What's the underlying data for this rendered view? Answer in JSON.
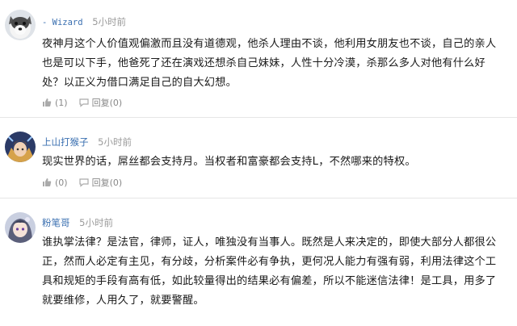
{
  "comments": [
    {
      "user": "- Wizard",
      "time": "5小时前",
      "lines": [
        "夜神月这个人价值观偏激而且没有道德观，他杀人理由不谈，他利用女朋友也不谈，自己的亲人",
        "也是可以下手，他爸死了还在演戏还想杀自己妹妹，人性十分冷漠，杀那么多人对他有什么好",
        "处？以正义为借口满足自己的自大幻想。"
      ],
      "like_count": "(1)",
      "reply_label": "回复(0)",
      "avatar_icon": "dog-avatar-icon"
    },
    {
      "user": "上山打猴子",
      "time": "5小时前",
      "lines": [
        "现实世界的话，屌丝都会支持月。当权者和富豪都会支持L，不然哪来的特权。"
      ],
      "like_count": "(0)",
      "reply_label": "回复(0)",
      "avatar_icon": "anime-character-avatar-icon"
    },
    {
      "user": "粉笔哥",
      "time": "5小时前",
      "lines": [
        "谁执掌法律？是法官，律师，证人，唯独没有当事人。既然是人来决定的，即使大部分人都很公",
        "正，然而人必定有主见，有分歧，分析案件必有争执，更何况人能力有强有弱，利用法律这个工",
        "具和规矩的手段有高有低，如此较量得出的结果必有偏差，所以不能迷信法律！是工具，用多了",
        "就要维修，人用久了，就要警醒。"
      ],
      "like_count": "(0)",
      "reply_label": "回复(0)",
      "avatar_icon": "anime-girl-avatar-icon"
    }
  ],
  "colors": {
    "username": "#3a6fb0",
    "meta": "#999999",
    "divider": "#e6e6e6"
  }
}
